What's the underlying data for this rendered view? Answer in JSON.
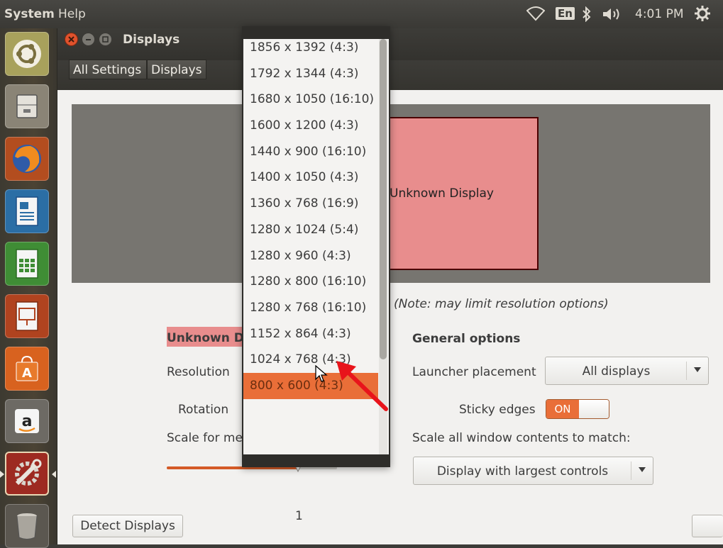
{
  "top_panel": {
    "menu_system": "System",
    "menu_help": "Help",
    "keyboard_layout": "En",
    "clock": "4:01 PM"
  },
  "launcher": {
    "items": [
      "ubuntu-logo",
      "file-cabinet",
      "firefox",
      "writer",
      "calc",
      "impress",
      "software-center",
      "amazon",
      "system-settings",
      "trash"
    ]
  },
  "window": {
    "title": "Displays",
    "breadcrumbs": [
      "All Settings",
      "Displays"
    ]
  },
  "monitor": {
    "label": "Unknown Display"
  },
  "note": "(Note: may limit resolution options)",
  "left_panel": {
    "display_name": "Unknown Di",
    "resolution_label": "Resolution",
    "rotation_label": "Rotation",
    "scale_label": "Scale for me",
    "scale_value": "1",
    "scale_fraction": 0.78
  },
  "general": {
    "heading": "General options",
    "launcher_placement_label": "Launcher placement",
    "launcher_placement_value": "All displays",
    "sticky_edges_label": "Sticky edges",
    "sticky_edges_state": "ON",
    "scale_all_label": "Scale all window contents to match:",
    "scale_all_value": "Display with largest controls"
  },
  "buttons": {
    "detect_displays": "Detect Displays"
  },
  "resolution_dropdown": {
    "options": [
      "1856 x 1392 (4:3)",
      "1792 x 1344 (4:3)",
      "1680 x 1050 (16:10)",
      "1600 x 1200 (4:3)",
      "1440 x 900 (16:10)",
      "1400 x 1050 (4:3)",
      "1360 x 768 (16:9)",
      "1280 x 1024 (5:4)",
      "1280 x 960 (4:3)",
      "1280 x 800 (16:10)",
      "1280 x 768 (16:10)",
      "1152 x 864 (4:3)",
      "1024 x 768 (4:3)",
      "800 x 600 (4:3)"
    ],
    "selected_index": 13
  },
  "colors": {
    "accent": "#e96e38",
    "monitor_fill": "#e88d8d",
    "panel_bg": "#3c3b37",
    "annotation_arrow": "#e8141b"
  }
}
